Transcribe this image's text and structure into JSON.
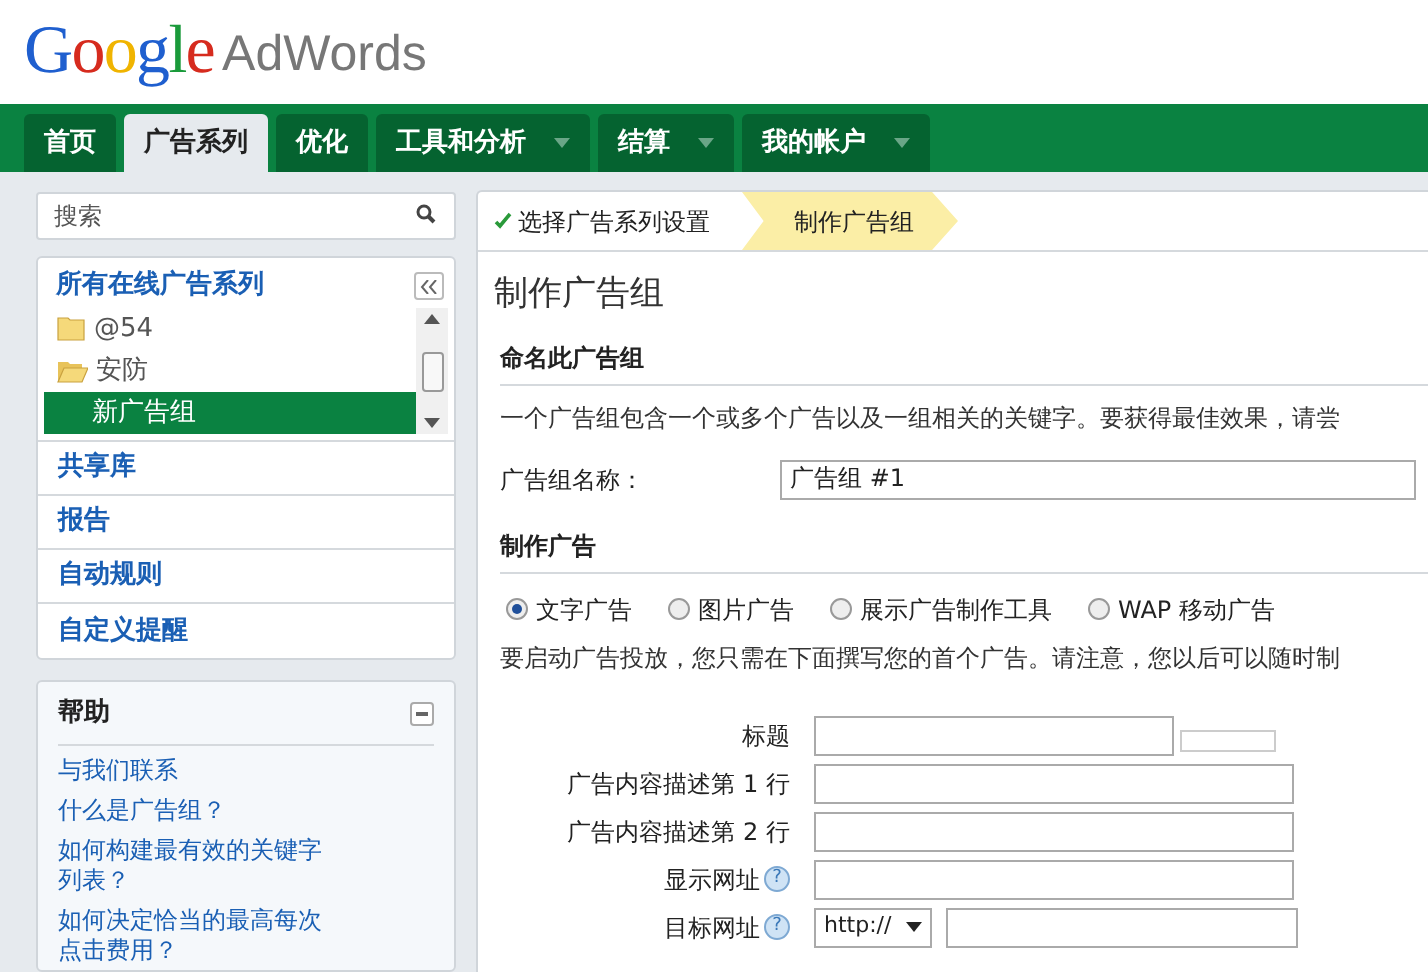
{
  "header": {
    "logo": "Google",
    "product": "AdWords"
  },
  "nav_tabs": [
    {
      "label": "首页",
      "selected": false,
      "menu": false
    },
    {
      "label": "广告系列",
      "selected": true,
      "menu": false
    },
    {
      "label": "优化",
      "selected": false,
      "menu": false
    },
    {
      "label": "工具和分析",
      "selected": false,
      "menu": true
    },
    {
      "label": "结算",
      "selected": false,
      "menu": true
    },
    {
      "label": "我的帐户",
      "selected": false,
      "menu": true
    }
  ],
  "sidebar": {
    "search": {
      "placeholder": "搜索"
    },
    "campaigns": {
      "title": "所有在线广告系列",
      "items": [
        {
          "label": "@54",
          "expanded": false,
          "selected": false
        },
        {
          "label": "安防",
          "expanded": true,
          "selected": false,
          "children": [
            {
              "label": "新广告组",
              "selected": true
            }
          ]
        }
      ]
    },
    "links": [
      "共享库",
      "报告",
      "自动规则",
      "自定义提醒"
    ],
    "help": {
      "title": "帮助",
      "expanded": true,
      "links": [
        "与我们联系",
        "什么是广告组？",
        "如何构建最有效的关键字列表？",
        "如何决定恰当的最高每次点击费用？"
      ]
    }
  },
  "main": {
    "steps": [
      {
        "label": "选择广告系列设置",
        "done": true,
        "selected": false
      },
      {
        "label": "制作广告组",
        "done": false,
        "selected": true
      }
    ],
    "title": "制作广告组",
    "name_section": {
      "heading": "命名此广告组",
      "description": "一个广告组包含一个或多个广告以及一组相关的关键字。要获得最佳效果，请尝",
      "field_label": "广告组名称：",
      "field_value": "广告组 #1"
    },
    "ad_section": {
      "heading": "制作广告",
      "ad_types": [
        {
          "label": "文字广告",
          "selected": true
        },
        {
          "label": "图片广告",
          "selected": false
        },
        {
          "label": "展示广告制作工具",
          "selected": false
        },
        {
          "label": "WAP 移动广告",
          "selected": false
        }
      ],
      "description": "要启动广告投放，您只需在下面撰写您的首个广告。请注意，您以后可以随时制",
      "fields": [
        {
          "kind": "counter",
          "label": "标题"
        },
        {
          "kind": "text",
          "label": "广告内容描述第 1 行"
        },
        {
          "kind": "text",
          "label": "广告内容描述第 2 行"
        },
        {
          "kind": "text",
          "label": "显示网址",
          "help": "?"
        },
        {
          "kind": "url",
          "label": "目标网址",
          "help": "?",
          "protocol": "http://"
        }
      ]
    }
  }
}
